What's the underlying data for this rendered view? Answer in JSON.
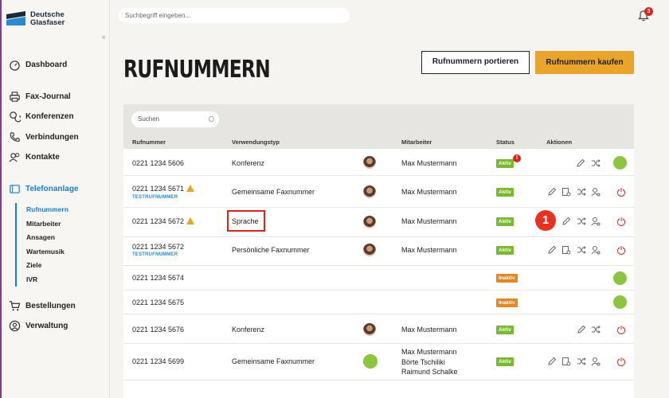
{
  "brand": {
    "line1": "Deutsche",
    "line2": "Glasfaser"
  },
  "search_top": {
    "placeholder": "Suchbegriff eingeben..."
  },
  "notifications": {
    "count": "3"
  },
  "sidebar": {
    "items": [
      {
        "label": "Dashboard",
        "icon": "gauge-icon"
      },
      {
        "label": "Fax-Journal",
        "icon": "printer-icon"
      },
      {
        "label": "Konferenzen",
        "icon": "chat-icon"
      },
      {
        "label": "Verbindungen",
        "icon": "phone-icon"
      },
      {
        "label": "Kontakte",
        "icon": "contacts-icon"
      },
      {
        "label": "Telefonanlage",
        "icon": "switchboard-icon"
      },
      {
        "label": "Bestellungen",
        "icon": "cart-icon"
      },
      {
        "label": "Verwaltung",
        "icon": "user-circle-icon"
      }
    ],
    "sub_items": [
      "Rufnummern",
      "Mitarbeiter",
      "Ansagen",
      "Wartemusik",
      "Ziele",
      "IVR"
    ]
  },
  "page": {
    "title": "RUFNUMMERN",
    "port_button": "Rufnummern portieren",
    "buy_button": "Rufnummern kaufen"
  },
  "table": {
    "search_placeholder": "Suchen",
    "headers": [
      "Rufnummer",
      "Verwendungstyp",
      "Mitarbeiter",
      "Status",
      "Aktionen"
    ],
    "test_label": "TESTRUFNUMMER",
    "rows": [
      {
        "number": "0221 1234 5606",
        "type": "Konferenz",
        "employee": "Max Mustermann",
        "status": "Aktiv"
      },
      {
        "number": "0221 1234 5671",
        "type": "Gemeinsame Faxnummer",
        "employee": "Max Mustermann",
        "status": "Aktiv"
      },
      {
        "number": "0221 1234 5672",
        "type": "Sprache",
        "employee": "Max Mustermann",
        "status": "Aktiv"
      },
      {
        "number": "0221 1234 5672",
        "type": "Persönliche Faxnummer",
        "employee": "Max Mustermann",
        "status": "Aktiv"
      },
      {
        "number": "0221 1234 5674",
        "type": "",
        "employee": "",
        "status": "Inaktiv"
      },
      {
        "number": "0221 1234 5675",
        "type": "",
        "employee": "",
        "status": "Inaktiv"
      },
      {
        "number": "0221 1234 5676",
        "type": "Konferenz",
        "employee": "Max Mustermann",
        "status": "Aktiv"
      },
      {
        "number": "0221 1234 5699",
        "type": "Gemeinsame Faxnummer",
        "employee": [
          "Max Mustermann",
          "Börte Tschiliki",
          "Raimund Schalke"
        ],
        "status": "Aktiv"
      }
    ],
    "status_alert": "!"
  },
  "annotation": {
    "step": "1"
  },
  "colors": {
    "accent_blue": "#1a7fd0",
    "buy_orange": "#e9a52b",
    "active_green": "#7ab833",
    "inactive_orange": "#e5861f",
    "alert_red": "#d8261c"
  }
}
